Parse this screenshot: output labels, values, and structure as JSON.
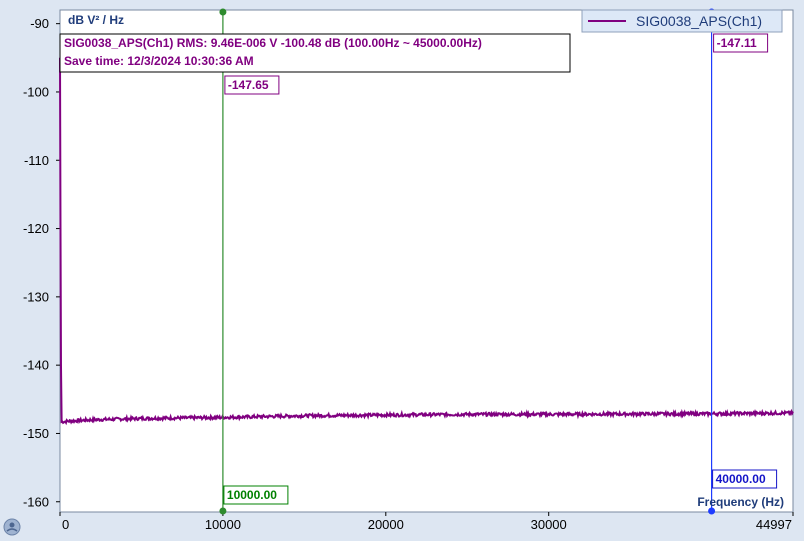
{
  "chart_data": {
    "type": "line",
    "ylabel_unit": "dB V² / Hz",
    "xlabel": "Frequency (Hz)",
    "xlim": [
      0,
      44997
    ],
    "ylim": [
      -161.5,
      -88
    ],
    "x_ticks": [
      0,
      10000,
      20000,
      30000,
      44997
    ],
    "y_ticks": [
      -90,
      -100,
      -110,
      -120,
      -130,
      -140,
      -150,
      -160
    ],
    "legend": "SIG0038_APS(Ch1)",
    "legend_position": "top-right",
    "grid": false,
    "info_line1": "SIG0038_APS(Ch1) RMS: 9.46E-006 V -100.48 dB (100.00Hz ~ 45000.00Hz)",
    "info_line2": "Save time: 12/3/2024 10:30:36 AM",
    "series": [
      {
        "name": "SIG0038_APS(Ch1)",
        "color": "#800080",
        "x": [
          0,
          30,
          60,
          100,
          500,
          2000,
          5000,
          10000,
          15000,
          20000,
          25000,
          30000,
          35000,
          40000,
          44997
        ],
        "y": [
          -95,
          -120,
          -140,
          -148.3,
          -148.2,
          -148.0,
          -147.8,
          -147.65,
          -147.4,
          -147.3,
          -147.2,
          -147.2,
          -147.15,
          -147.11,
          -147.0
        ]
      }
    ],
    "cursors": [
      {
        "x": 10000,
        "x_label": "10000.00",
        "y_label": "-147.65",
        "color": "#2e8b2e",
        "label_color": "#008000"
      },
      {
        "x": 40000,
        "x_label": "40000.00",
        "y_label": "-147.11",
        "color": "#1e3cff",
        "label_color": "#1414c8"
      }
    ]
  }
}
